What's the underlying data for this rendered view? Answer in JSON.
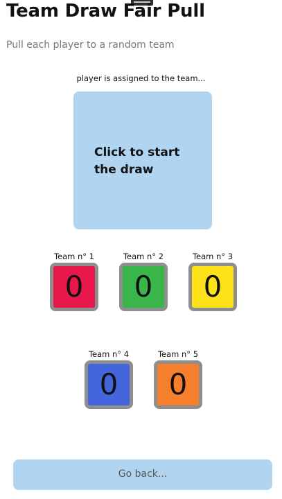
{
  "header": {
    "title": "Team Draw Fair Pull",
    "subtitle": "Pull each player to a random team"
  },
  "draw": {
    "assigned_label": "player is assigned to the team...",
    "prompt": "Click to start the draw"
  },
  "teams": [
    {
      "label": "Team n° 1",
      "count": "0",
      "color": "#e8184d"
    },
    {
      "label": "Team n° 2",
      "count": "0",
      "color": "#3ab54a"
    },
    {
      "label": "Team n° 3",
      "count": "0",
      "color": "#ffe11a"
    },
    {
      "label": "Team n° 4",
      "count": "0",
      "color": "#4466dd"
    },
    {
      "label": "Team n° 5",
      "count": "0",
      "color": "#f57f2c"
    }
  ],
  "footer": {
    "back_label": "Go back..."
  },
  "colors": {
    "accent_light_blue": "#b1d5f1",
    "tile_border": "#8e8e8e"
  }
}
